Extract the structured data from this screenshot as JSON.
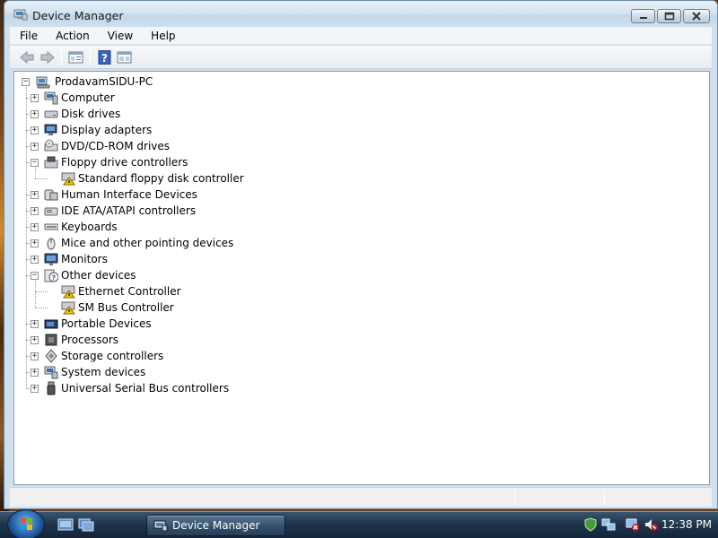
{
  "window": {
    "title": "Device Manager",
    "title_icon": "device-manager-icon"
  },
  "menu": [
    "File",
    "Action",
    "View",
    "Help"
  ],
  "toolbar": {
    "buttons": [
      "back-arrow-icon",
      "forward-arrow-icon",
      "properties-view-icon",
      "help-icon",
      "console-tree-icon"
    ]
  },
  "tree": {
    "root": {
      "label": "ProdavamSIDU-PC",
      "icon": "computer-root-icon"
    },
    "items": [
      {
        "label": "Computer",
        "icon": "computer-icon",
        "expanded": false
      },
      {
        "label": "Disk drives",
        "icon": "disk-drive-icon",
        "expanded": false
      },
      {
        "label": "Display adapters",
        "icon": "display-adapter-icon",
        "expanded": false
      },
      {
        "label": "DVD/CD-ROM drives",
        "icon": "dvd-drive-icon",
        "expanded": false
      },
      {
        "label": "Floppy drive controllers",
        "icon": "floppy-controller-icon",
        "expanded": true,
        "children": [
          {
            "label": "Standard floppy disk controller",
            "icon": "warning-device-icon"
          }
        ]
      },
      {
        "label": "Human Interface Devices",
        "icon": "hid-icon",
        "expanded": false
      },
      {
        "label": "IDE ATA/ATAPI controllers",
        "icon": "ide-controller-icon",
        "expanded": false
      },
      {
        "label": "Keyboards",
        "icon": "keyboard-icon",
        "expanded": false
      },
      {
        "label": "Mice and other pointing devices",
        "icon": "mouse-icon",
        "expanded": false
      },
      {
        "label": "Monitors",
        "icon": "monitor-icon",
        "expanded": false
      },
      {
        "label": "Other devices",
        "icon": "unknown-device-icon",
        "expanded": true,
        "children": [
          {
            "label": "Ethernet Controller",
            "icon": "warning-device-icon"
          },
          {
            "label": "SM Bus Controller",
            "icon": "warning-device-icon"
          }
        ]
      },
      {
        "label": "Portable Devices",
        "icon": "portable-device-icon",
        "expanded": false
      },
      {
        "label": "Processors",
        "icon": "processor-icon",
        "expanded": false
      },
      {
        "label": "Storage controllers",
        "icon": "storage-controller-icon",
        "expanded": false
      },
      {
        "label": "System devices",
        "icon": "system-device-icon",
        "expanded": false
      },
      {
        "label": "Universal Serial Bus controllers",
        "icon": "usb-icon",
        "expanded": false
      }
    ]
  },
  "taskbar": {
    "start_icon": "windows-start-orb-icon",
    "quick_launch": [
      "show-desktop-icon",
      "switch-windows-icon"
    ],
    "task_button": {
      "label": "Device Manager",
      "icon": "device-manager-icon"
    },
    "tray": [
      "security-shield-icon",
      "network-icon",
      "network-disconnected-icon",
      "volume-muted-icon"
    ],
    "clock": "12:38 PM"
  },
  "colors": {
    "window_frame": "#cfe0ee",
    "taskbar": "#1d3349",
    "warning": "#f2c200"
  }
}
